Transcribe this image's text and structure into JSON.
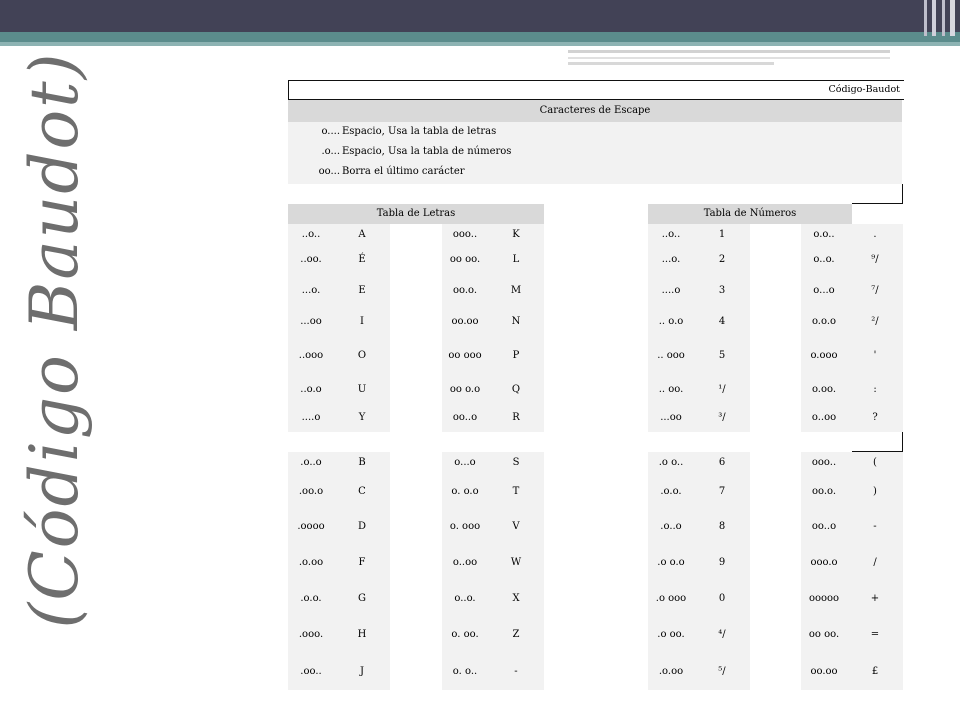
{
  "slide_title": "(Código Baudot)",
  "table": {
    "title": "Código-Baudot",
    "escape": {
      "header": "Caracteres de Escape",
      "rows": [
        {
          "code": "o....",
          "desc": "Espacio, Usa la tabla de letras"
        },
        {
          "code": ".o...",
          "desc": "Espacio, Usa la tabla de números"
        },
        {
          "code": "oo...",
          "desc": "Borra el último carácter"
        }
      ]
    },
    "letras_header": "Tabla de Letras",
    "numeros_header": "Tabla de Números",
    "letras_a": [
      [
        "..o..",
        "A",
        "ooo..",
        "K"
      ],
      [
        "..oo.",
        "É",
        "oo oo.",
        "L"
      ],
      [
        "...o.",
        "E",
        "oo.o.",
        "M"
      ],
      [
        "...oo",
        "I",
        "oo.oo",
        "N"
      ],
      [
        "..ooo",
        "O",
        "oo ooo",
        "P"
      ],
      [
        "..o.o",
        "U",
        "oo o.o",
        "Q"
      ],
      [
        "....o",
        "Y",
        "oo..o",
        "R"
      ]
    ],
    "numeros_a": [
      [
        "..o..",
        "1",
        "o.o..",
        "."
      ],
      [
        "...o.",
        "2",
        "o..o.",
        "⁹/"
      ],
      [
        "....o",
        "3",
        "o...o",
        "⁷/"
      ],
      [
        ".. o.o",
        "4",
        "o.o.o",
        "²/"
      ],
      [
        ".. ooo",
        "5",
        "o.ooo",
        "'"
      ],
      [
        ".. oo.",
        "¹/",
        "o.oo.",
        ":"
      ],
      [
        "...oo",
        "³/",
        "o..oo",
        "?"
      ]
    ],
    "letras_b": [
      [
        ".o..o",
        "B",
        "o...o",
        "S"
      ],
      [
        ".oo.o",
        "C",
        "o. o.o",
        "T"
      ],
      [
        ".oooo",
        "D",
        "o. ooo",
        "V"
      ],
      [
        ".o.oo",
        "F",
        "o..oo",
        "W"
      ],
      [
        ".o.o.",
        "G",
        "o..o.",
        "X"
      ],
      [
        ".ooo.",
        "H",
        "o. oo.",
        "Z"
      ],
      [
        ".oo..",
        "J",
        "o. o..",
        "-"
      ]
    ],
    "numeros_b": [
      [
        ".o o..",
        "6",
        "ooo..",
        "("
      ],
      [
        ".o.o.",
        "7",
        "oo.o.",
        ")"
      ],
      [
        ".o..o",
        "8",
        "oo..o",
        "-"
      ],
      [
        ".o o.o",
        "9",
        "ooo.o",
        "/"
      ],
      [
        ".o ooo",
        "0",
        "ooooo",
        "+"
      ],
      [
        ".o oo.",
        "⁴/",
        "oo oo.",
        "="
      ],
      [
        ".o.oo",
        "⁵/",
        "oo.oo",
        "£"
      ]
    ]
  }
}
